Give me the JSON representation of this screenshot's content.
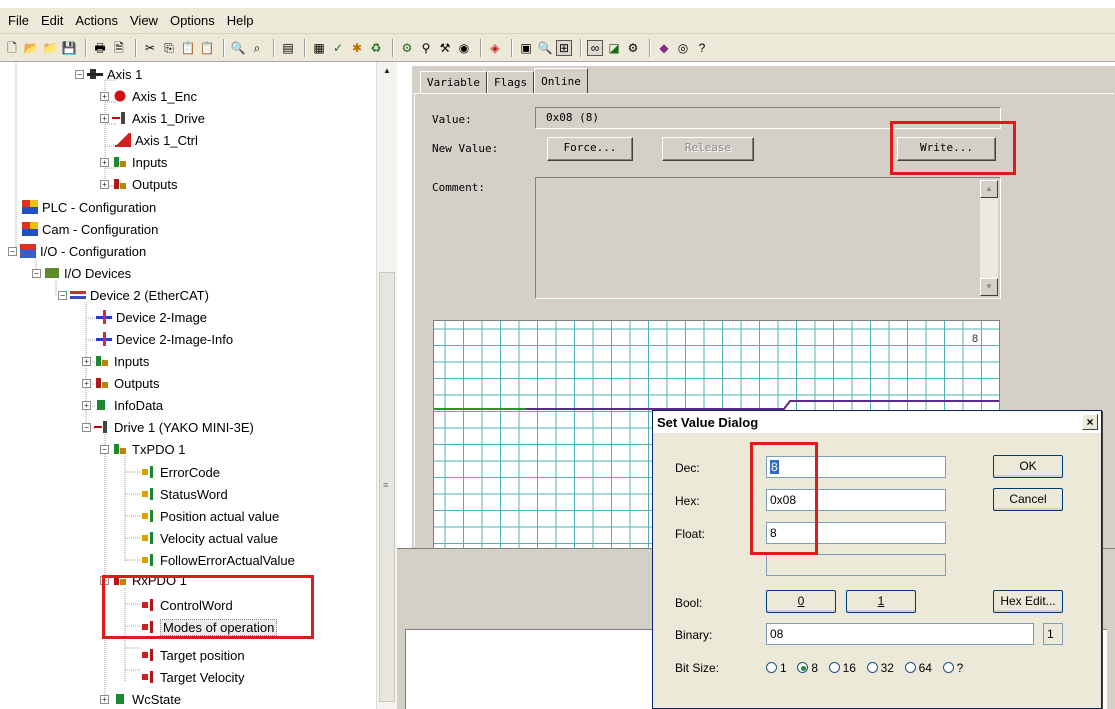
{
  "menubar": {
    "items": [
      "File",
      "Edit",
      "Actions",
      "View",
      "Options",
      "Help"
    ]
  },
  "toolbar": {
    "icons": [
      "new-file-icon",
      "open-folder-icon",
      "open-project-icon",
      "save-icon",
      "print-icon",
      "print-preview-icon",
      "cut-icon",
      "copy-icon",
      "paste-icon",
      "paste-link-icon",
      "find-icon",
      "find-next-icon",
      "toggle-view-icon",
      "network-icon",
      "check-icon",
      "activate-config-icon",
      "restart-icon",
      "set-run-mode-icon",
      "network-scan-icon",
      "hammer-icon",
      "config-mode-icon",
      "target-icon",
      "zoom-icon",
      "online-icon",
      "show-online-icon",
      "monitor-icon",
      "help-book-icon",
      "about-icon",
      "question-icon"
    ]
  },
  "tree": {
    "items": [
      {
        "label": "Axis 1",
        "icon": "axis-icon",
        "exp": "minus"
      },
      {
        "label": "Axis 1_Enc",
        "icon": "encoder-icon",
        "exp": "plus"
      },
      {
        "label": "Axis 1_Drive",
        "icon": "drive-icon",
        "exp": "plus"
      },
      {
        "label": "Axis 1_Ctrl",
        "icon": "controller-icon",
        "exp": ""
      },
      {
        "label": "Inputs",
        "icon": "inputs-icon",
        "exp": "plus"
      },
      {
        "label": "Outputs",
        "icon": "outputs-icon",
        "exp": "plus"
      },
      {
        "label": "PLC - Configuration",
        "icon": "plc-icon",
        "exp": ""
      },
      {
        "label": "Cam - Configuration",
        "icon": "cam-icon",
        "exp": ""
      },
      {
        "label": "I/O - Configuration",
        "icon": "io-config-icon",
        "exp": "minus"
      },
      {
        "label": "I/O Devices",
        "icon": "io-devices-icon",
        "exp": "minus"
      },
      {
        "label": "Device 2 (EtherCAT)",
        "icon": "ethercat-icon",
        "exp": "minus"
      },
      {
        "label": "Device 2-Image",
        "icon": "image-icon",
        "exp": ""
      },
      {
        "label": "Device 2-Image-Info",
        "icon": "image-info-icon",
        "exp": ""
      },
      {
        "label": "Inputs",
        "icon": "inputs-icon",
        "exp": "plus"
      },
      {
        "label": "Outputs",
        "icon": "outputs-icon",
        "exp": "plus"
      },
      {
        "label": "InfoData",
        "icon": "infodata-icon",
        "exp": "plus"
      },
      {
        "label": "Drive 1 (YAKO MINI-3E)",
        "icon": "drive-icon",
        "exp": "minus"
      },
      {
        "label": "TxPDO 1",
        "icon": "inputs-icon",
        "exp": "minus"
      },
      {
        "label": "ErrorCode",
        "icon": "variable-in-icon",
        "exp": ""
      },
      {
        "label": "StatusWord",
        "icon": "variable-in-icon",
        "exp": ""
      },
      {
        "label": "Position actual value",
        "icon": "variable-in-icon",
        "exp": ""
      },
      {
        "label": "Velocity actual value",
        "icon": "variable-in-icon",
        "exp": ""
      },
      {
        "label": "FollowErrorActualValue",
        "icon": "variable-in-icon",
        "exp": ""
      },
      {
        "label": "RxPDO 1",
        "icon": "outputs-icon",
        "exp": "minus"
      },
      {
        "label": "ControlWord",
        "icon": "variable-out-icon",
        "exp": ""
      },
      {
        "label": "Modes of operation",
        "icon": "variable-out-icon",
        "exp": ""
      },
      {
        "label": "Target position",
        "icon": "variable-out-icon",
        "exp": ""
      },
      {
        "label": "Target Velocity",
        "icon": "variable-out-icon",
        "exp": ""
      },
      {
        "label": "WcState",
        "icon": "wcstate-icon",
        "exp": "plus"
      }
    ]
  },
  "tabs": [
    {
      "label": "Variable"
    },
    {
      "label": "Flags"
    },
    {
      "label": "Online"
    }
  ],
  "online": {
    "value_label": "Value:",
    "value": "0x08 (8)",
    "new_value_label": "New Value:",
    "force_button": "Force...",
    "release_button": "Release",
    "write_button": "Write...",
    "comment_label": "Comment:"
  },
  "chart": {
    "value_label": "8"
  },
  "dialog": {
    "title": "Set Value Dialog",
    "dec_label": "Dec:",
    "dec_value": "8",
    "hex_label": "Hex:",
    "hex_value": "0x08",
    "float_label": "Float:",
    "float_value": "8",
    "ok_button": "OK",
    "cancel_button": "Cancel",
    "bool_label": "Bool:",
    "bool_0": "0",
    "bool_1": "1",
    "hex_edit_button": "Hex Edit...",
    "binary_label": "Binary:",
    "binary_value": "08",
    "binary_count": "1",
    "bitsize_label": "Bit Size:",
    "bitsize_options": [
      "1",
      "8",
      "16",
      "32",
      "64",
      "?"
    ],
    "bitsize_selected": "8"
  },
  "colors": {
    "highlight": "#e01a1a",
    "panel": "#d4d0c8",
    "grid": "#4fb3b3",
    "trace_green": "#1c9a2a",
    "trace_purple": "#5a2a8a"
  }
}
